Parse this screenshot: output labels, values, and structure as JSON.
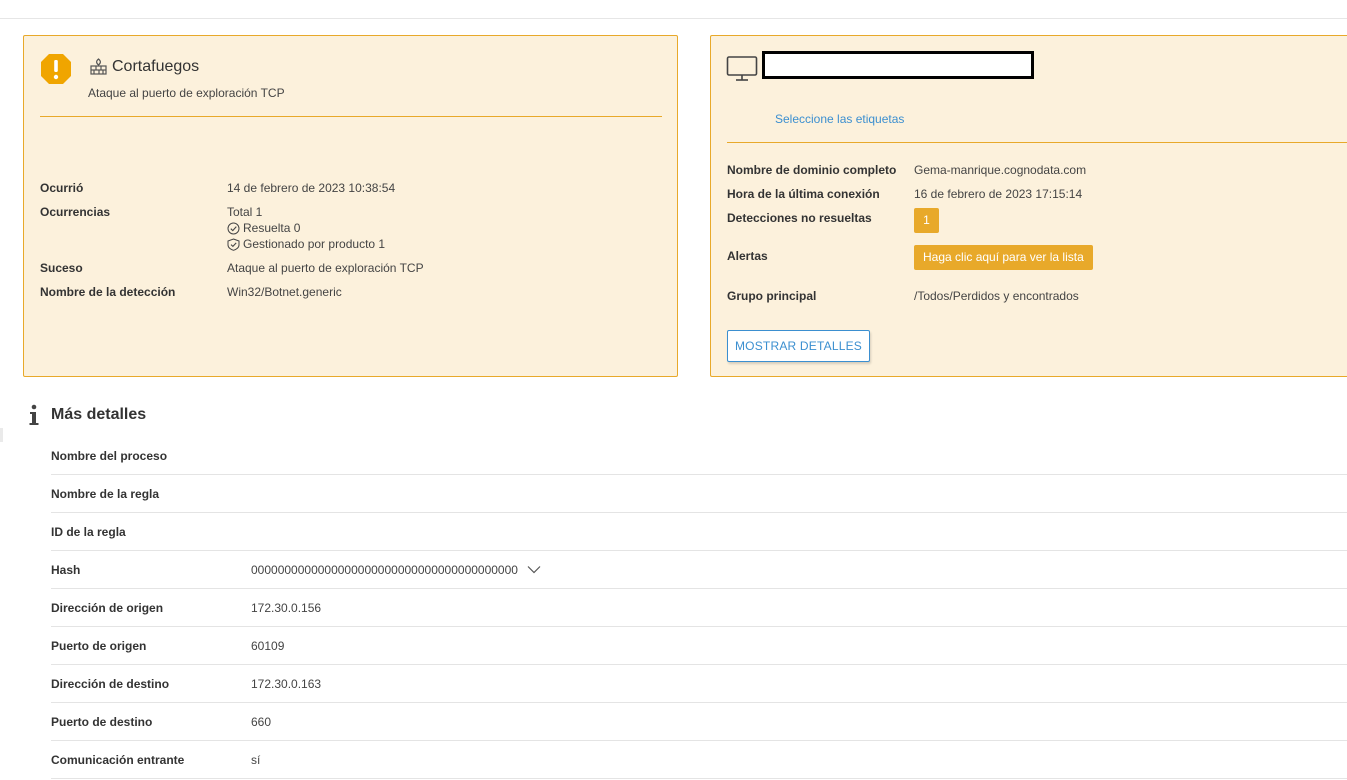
{
  "detection_card": {
    "title": "Cortafuegos",
    "subtitle": "Ataque al puerto de exploración TCP",
    "rows": {
      "occurred_label": "Ocurrió",
      "occurred_value": "14 de febrero de 2023 10:38:54",
      "occurrences_label": "Ocurrencias",
      "occurrences_total": "Total 1",
      "occurrences_resolved": "Resuelta 0",
      "occurrences_managed": "Gestionado por producto 1",
      "event_label": "Suceso",
      "event_value": "Ataque al puerto de exploración TCP",
      "detection_name_label": "Nombre de la detección",
      "detection_name_value": "Win32/Botnet.generic"
    }
  },
  "computer_card": {
    "tags_link": "Seleccione las etiquetas",
    "rows": {
      "fqdn_label": "Nombre de dominio completo",
      "fqdn_value": "Gema-manrique.cognodata.com",
      "last_connection_label": "Hora de la última conexión",
      "last_connection_value": "16 de febrero de 2023 17:15:14",
      "unresolved_label": "Detecciones no resueltas",
      "unresolved_value": "1",
      "alerts_label": "Alertas",
      "alerts_button": "Haga clic aquí para ver la lista",
      "group_label": "Grupo principal",
      "group_value": "/Todos/Perdidos y encontrados"
    },
    "show_details_button": "MOSTRAR DETALLES"
  },
  "more_details": {
    "title": "Más detalles",
    "rows": [
      {
        "label": "Nombre del proceso",
        "value": ""
      },
      {
        "label": "Nombre de la regla",
        "value": ""
      },
      {
        "label": "ID de la regla",
        "value": ""
      },
      {
        "label": "Hash",
        "value": "0000000000000000000000000000000000000000"
      },
      {
        "label": "Dirección de origen",
        "value": "172.30.0.156"
      },
      {
        "label": "Puerto de origen",
        "value": "60109"
      },
      {
        "label": "Dirección de destino",
        "value": "172.30.0.163"
      },
      {
        "label": "Puerto de destino",
        "value": "660"
      },
      {
        "label": "Comunicación entrante",
        "value": "sí"
      }
    ]
  },
  "colors": {
    "accent": "#e8a92a",
    "card_background": "#fcf1dc",
    "link": "#3b8fd0"
  },
  "icons": {
    "warning": "warning-icon",
    "firewall": "firewall-icon",
    "computer": "monitor-icon",
    "info": "info-icon",
    "resolved": "check-circle-icon",
    "managed": "shield-check-icon",
    "expand": "chevron-down-icon"
  }
}
